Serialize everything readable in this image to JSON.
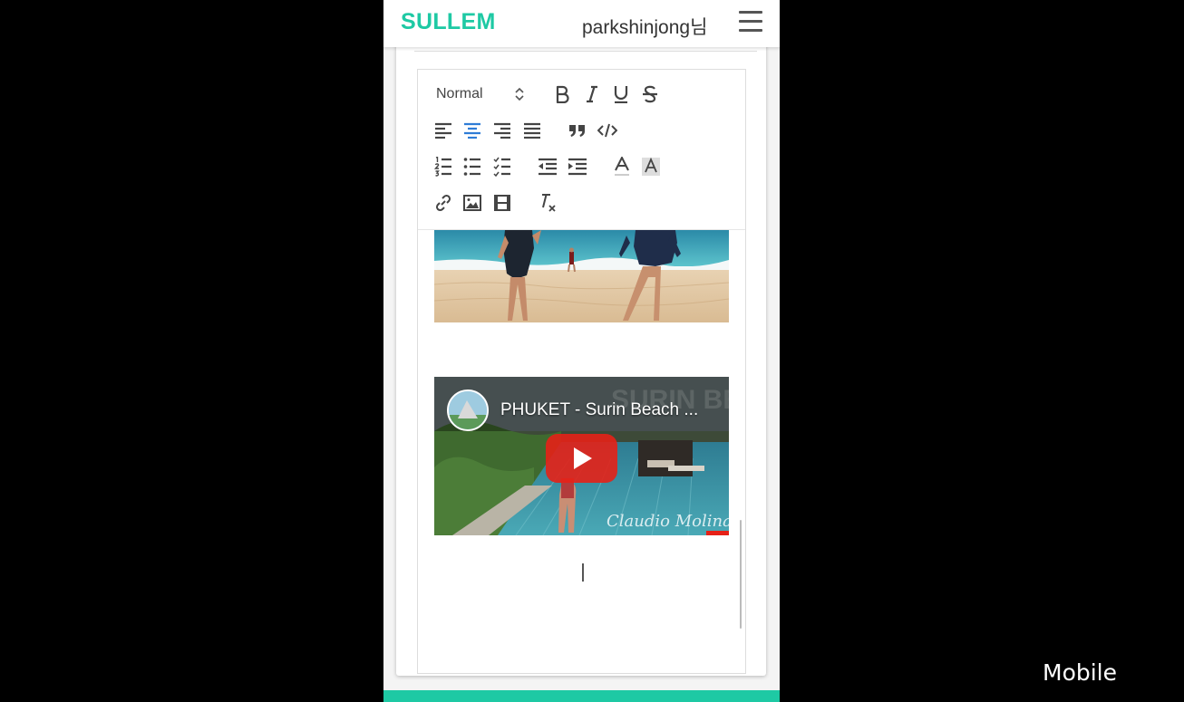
{
  "header": {
    "logo": "SULLEM",
    "username": "parkshinjong님"
  },
  "toolbar": {
    "format_select": "Normal",
    "buttons": [
      "bold-icon",
      "italic-icon",
      "underline-icon",
      "strike-icon",
      "align-left-icon",
      "align-center-icon",
      "align-right-icon",
      "align-justify-icon",
      "blockquote-icon",
      "code-block-icon",
      "ordered-list-icon",
      "bullet-list-icon",
      "check-list-icon",
      "indent-decrease-icon",
      "indent-increase-icon",
      "font-color-icon",
      "background-color-icon",
      "link-icon",
      "image-icon",
      "video-icon",
      "clear-format-icon"
    ],
    "active_button": "align-center-icon"
  },
  "video": {
    "title": "PHUKET - Surin Beach ...",
    "watermark": "SURIN BEACH",
    "signature": "Claudio Molina"
  },
  "overlay_label": "Mobile",
  "colors": {
    "brand": "#1ec9a4",
    "active": "#2f7cd6",
    "youtube_red": "#e62117"
  }
}
